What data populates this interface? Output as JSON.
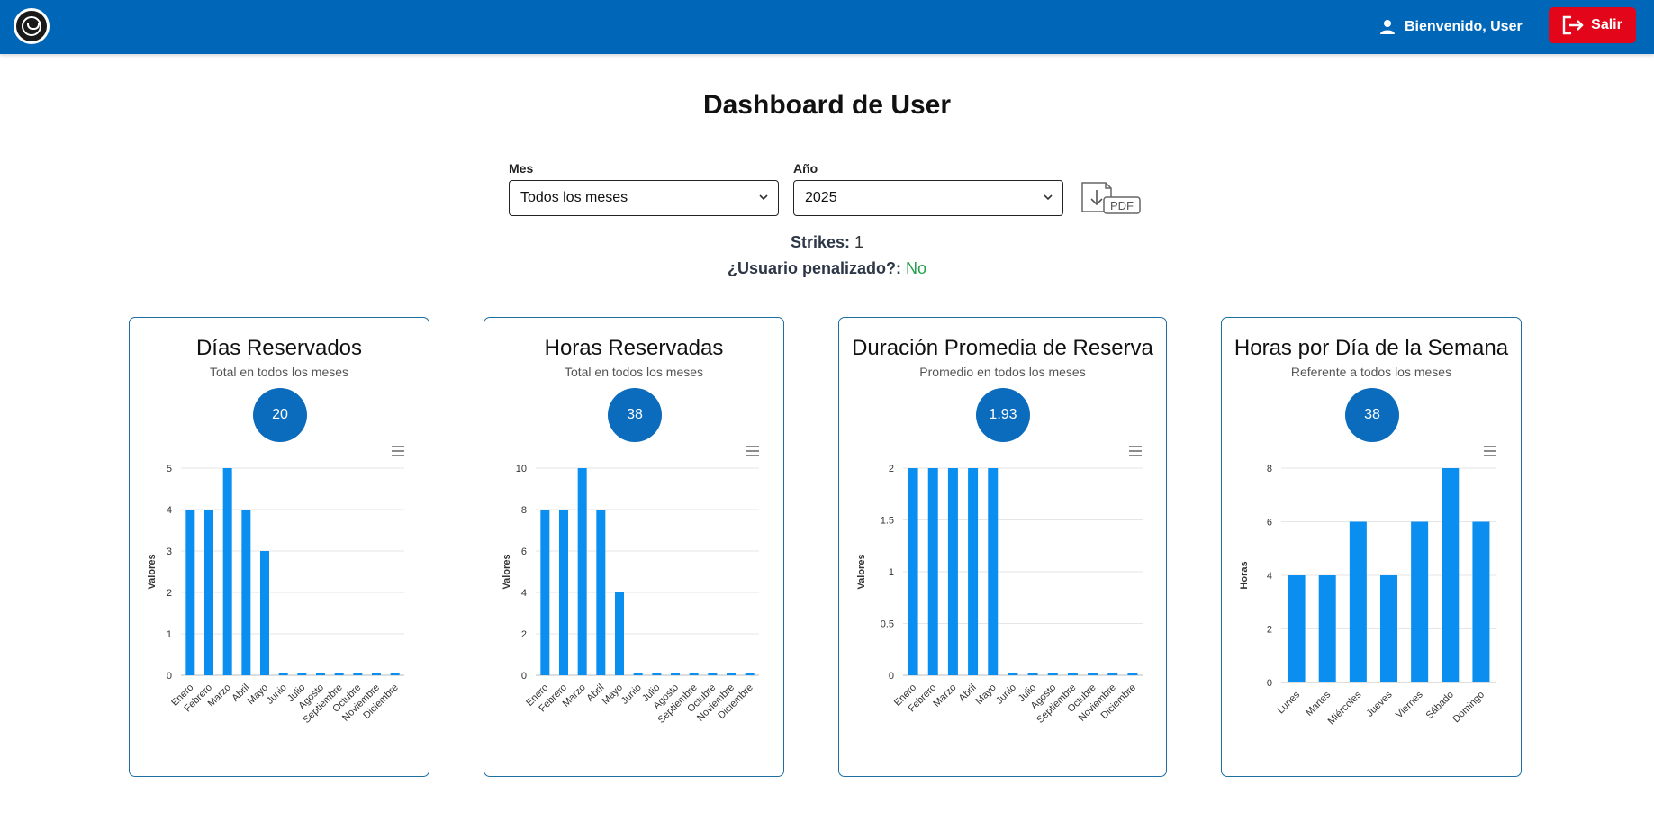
{
  "header": {
    "welcome_text": "Bienvenido, User",
    "logout_label": "Salir",
    "bar_color": "#0066b8",
    "logout_color": "#e3061b"
  },
  "page": {
    "title": "Dashboard de User"
  },
  "filters": {
    "month_label": "Mes",
    "month_value": "Todos los meses",
    "year_label": "Año",
    "year_value": "2025",
    "pdf_label": "PDF"
  },
  "status": {
    "strikes_label": "Strikes:",
    "strikes_value": "1",
    "penalized_label": "¿Usuario penalizado?:",
    "penalized_value": "No"
  },
  "cards": [
    {
      "title": "Días Reservados",
      "subtitle": "Total en todos los meses",
      "badge": "20"
    },
    {
      "title": "Horas Reservadas",
      "subtitle": "Total en todos los meses",
      "badge": "38"
    },
    {
      "title": "Duración Promedia de Reserva",
      "subtitle": "Promedio en todos los meses",
      "badge": "1.93"
    },
    {
      "title": "Horas por Día de la Semana",
      "subtitle": "Referente a todos los meses",
      "badge": "38"
    }
  ],
  "chart_data": [
    {
      "type": "bar",
      "ylabel": "Valores",
      "categories": [
        "Enero",
        "Febrero",
        "Marzo",
        "Abril",
        "Mayo",
        "Junio",
        "Julio",
        "Agosto",
        "Septiembre",
        "Octubre",
        "Noviembre",
        "Diciembre"
      ],
      "values": [
        4,
        4,
        5,
        4,
        3,
        0,
        0,
        0,
        0,
        0,
        0,
        0
      ],
      "ylim": [
        0,
        5
      ],
      "yticks": [
        "0",
        "1",
        "2",
        "3",
        "4",
        "5"
      ],
      "grid": true,
      "bar_color": "#0a8ff0"
    },
    {
      "type": "bar",
      "ylabel": "Valores",
      "categories": [
        "Enero",
        "Febrero",
        "Marzo",
        "Abril",
        "Mayo",
        "Junio",
        "Julio",
        "Agosto",
        "Septiembre",
        "Octubre",
        "Noviembre",
        "Diciembre"
      ],
      "values": [
        8,
        8,
        10,
        8,
        4,
        0,
        0,
        0,
        0,
        0,
        0,
        0
      ],
      "ylim": [
        0,
        10
      ],
      "yticks": [
        "0",
        "2",
        "4",
        "6",
        "8",
        "10"
      ],
      "grid": true,
      "bar_color": "#0a8ff0"
    },
    {
      "type": "bar",
      "ylabel": "Valores",
      "categories": [
        "Enero",
        "Febrero",
        "Marzo",
        "Abril",
        "Mayo",
        "Junio",
        "Julio",
        "Agosto",
        "Septiembre",
        "Octubre",
        "Noviembre",
        "Diciembre"
      ],
      "values": [
        2,
        2,
        2,
        2,
        2,
        0,
        0,
        0,
        0,
        0,
        0,
        0
      ],
      "ylim": [
        0,
        2
      ],
      "yticks": [
        "0",
        "0.5",
        "1",
        "1.5",
        "2"
      ],
      "grid": true,
      "bar_color": "#0a8ff0"
    },
    {
      "type": "bar",
      "ylabel": "Horas",
      "categories": [
        "Lunes",
        "Martes",
        "Miércoles",
        "Jueves",
        "Viernes",
        "Sábado",
        "Domingo"
      ],
      "values": [
        4,
        4,
        6,
        4,
        6,
        8,
        6
      ],
      "ylim": [
        0,
        8
      ],
      "yticks": [
        "0",
        "2",
        "4",
        "6",
        "8"
      ],
      "grid": true,
      "bar_color": "#0a8ff0"
    }
  ]
}
